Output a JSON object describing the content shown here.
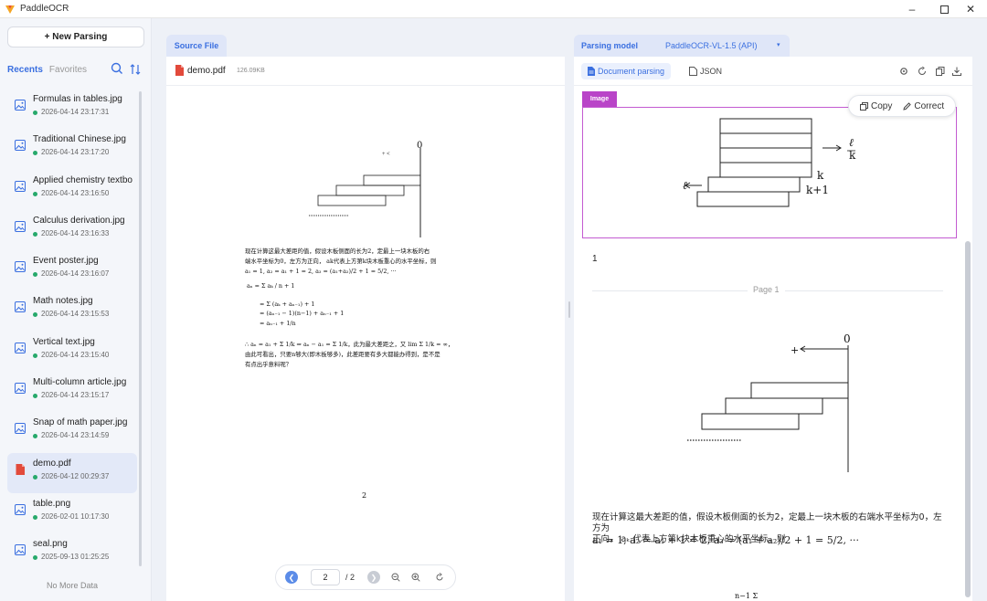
{
  "window": {
    "title": "PaddleOCR"
  },
  "sidebar": {
    "new_button": "+ New Parsing",
    "tab_recent": "Recents",
    "tab_favorites": "Favorites",
    "items": [
      {
        "name": "Formulas in tables.jpg",
        "date": "2026-04-14 23:17:31",
        "type": "image"
      },
      {
        "name": "Traditional Chinese.jpg",
        "date": "2026-04-14 23:17:20",
        "type": "image"
      },
      {
        "name": "Applied chemistry textbo",
        "date": "2026-04-14 23:16:50",
        "type": "image"
      },
      {
        "name": "Calculus derivation.jpg",
        "date": "2026-04-14 23:16:33",
        "type": "image"
      },
      {
        "name": "Event poster.jpg",
        "date": "2026-04-14 23:16:07",
        "type": "image"
      },
      {
        "name": "Math notes.jpg",
        "date": "2026-04-14 23:15:53",
        "type": "image"
      },
      {
        "name": "Vertical text.jpg",
        "date": "2026-04-14 23:15:40",
        "type": "image"
      },
      {
        "name": "Multi-column article.jpg",
        "date": "2026-04-14 23:15:17",
        "type": "image"
      },
      {
        "name": "Snap of math paper.jpg",
        "date": "2026-04-14 23:14:59",
        "type": "image"
      },
      {
        "name": "demo.pdf",
        "date": "2026-04-12 00:29:37",
        "type": "pdf"
      },
      {
        "name": "table.png",
        "date": "2026-02-01 10:17:30",
        "type": "image"
      },
      {
        "name": "seal.png",
        "date": "2025-09-13 01:25:25",
        "type": "image"
      }
    ],
    "no_more": "No More Data"
  },
  "source": {
    "tab": "Source File",
    "file_name": "demo.pdf",
    "file_size": "126.09KB",
    "page_current": "2",
    "page_total": "/ 2",
    "page_footer": "2",
    "origin_label": "0",
    "cn_lines": [
      "现在计算这最大差距的值，假设木板侧面的长为2，定最上一块木板的右",
      "端水平坐标为0，左方为正向，  ak代表上方第k块木板重心的水平坐标，则",
      "a₁ = 1, a₂ = a₁ + 1 = 2, a₃ = (a₁+a₂)/2 + 1 = 5/2, ···",
      "aₙ  =  Σ aₖ / n + 1",
      "=  Σ (aₖ + aₙ₋₁) + 1",
      "=  (aₙ₋₁ − 1)(n−1) + aₙ₋₁  + 1",
      "=  aₙ₋₁ + 1/n",
      "∴ aₙ = a₁ + Σ 1/k ⇒ aₙ − a₁ = Σ 1/k，此为最大差距之，又 lim Σ 1/k = ∞，",
      "由此可看出，只要n够大(即木板够多)，此差距要有多大都能办得到，是不是",
      "有点出乎意料呢？"
    ]
  },
  "result": {
    "model_label": "Parsing model",
    "model_value": "PaddleOCR-VL-1.5 (API)",
    "tab_doc": "Document parsing",
    "tab_json": "JSON",
    "image_tag": "Image",
    "copy": "Copy",
    "correct": "Correct",
    "fig_right_top": "ℓ",
    "fig_right_bottom": "k",
    "fig_k": "k",
    "fig_k1": "k+1",
    "fig_left": "ℓ",
    "page_number": "1",
    "page_label": "Page 1",
    "fig2_zero": "0",
    "fig2_plus": "+",
    "text_line1": "现在计算这最大差距的值，假设木板侧面的长为2，定最上一块木板的右端水平坐标为0，左方为",
    "text_line2": "正向，  aₖ 代表上方第k块木板重心的水平坐标，则",
    "math_line": "a₁ = 1, a₂ = a₁ + 1 = 2, a₃ = (a₁ + a₂)/2 + 1 = 5/2, ···",
    "sum_fragment": "n−1 Σ"
  }
}
